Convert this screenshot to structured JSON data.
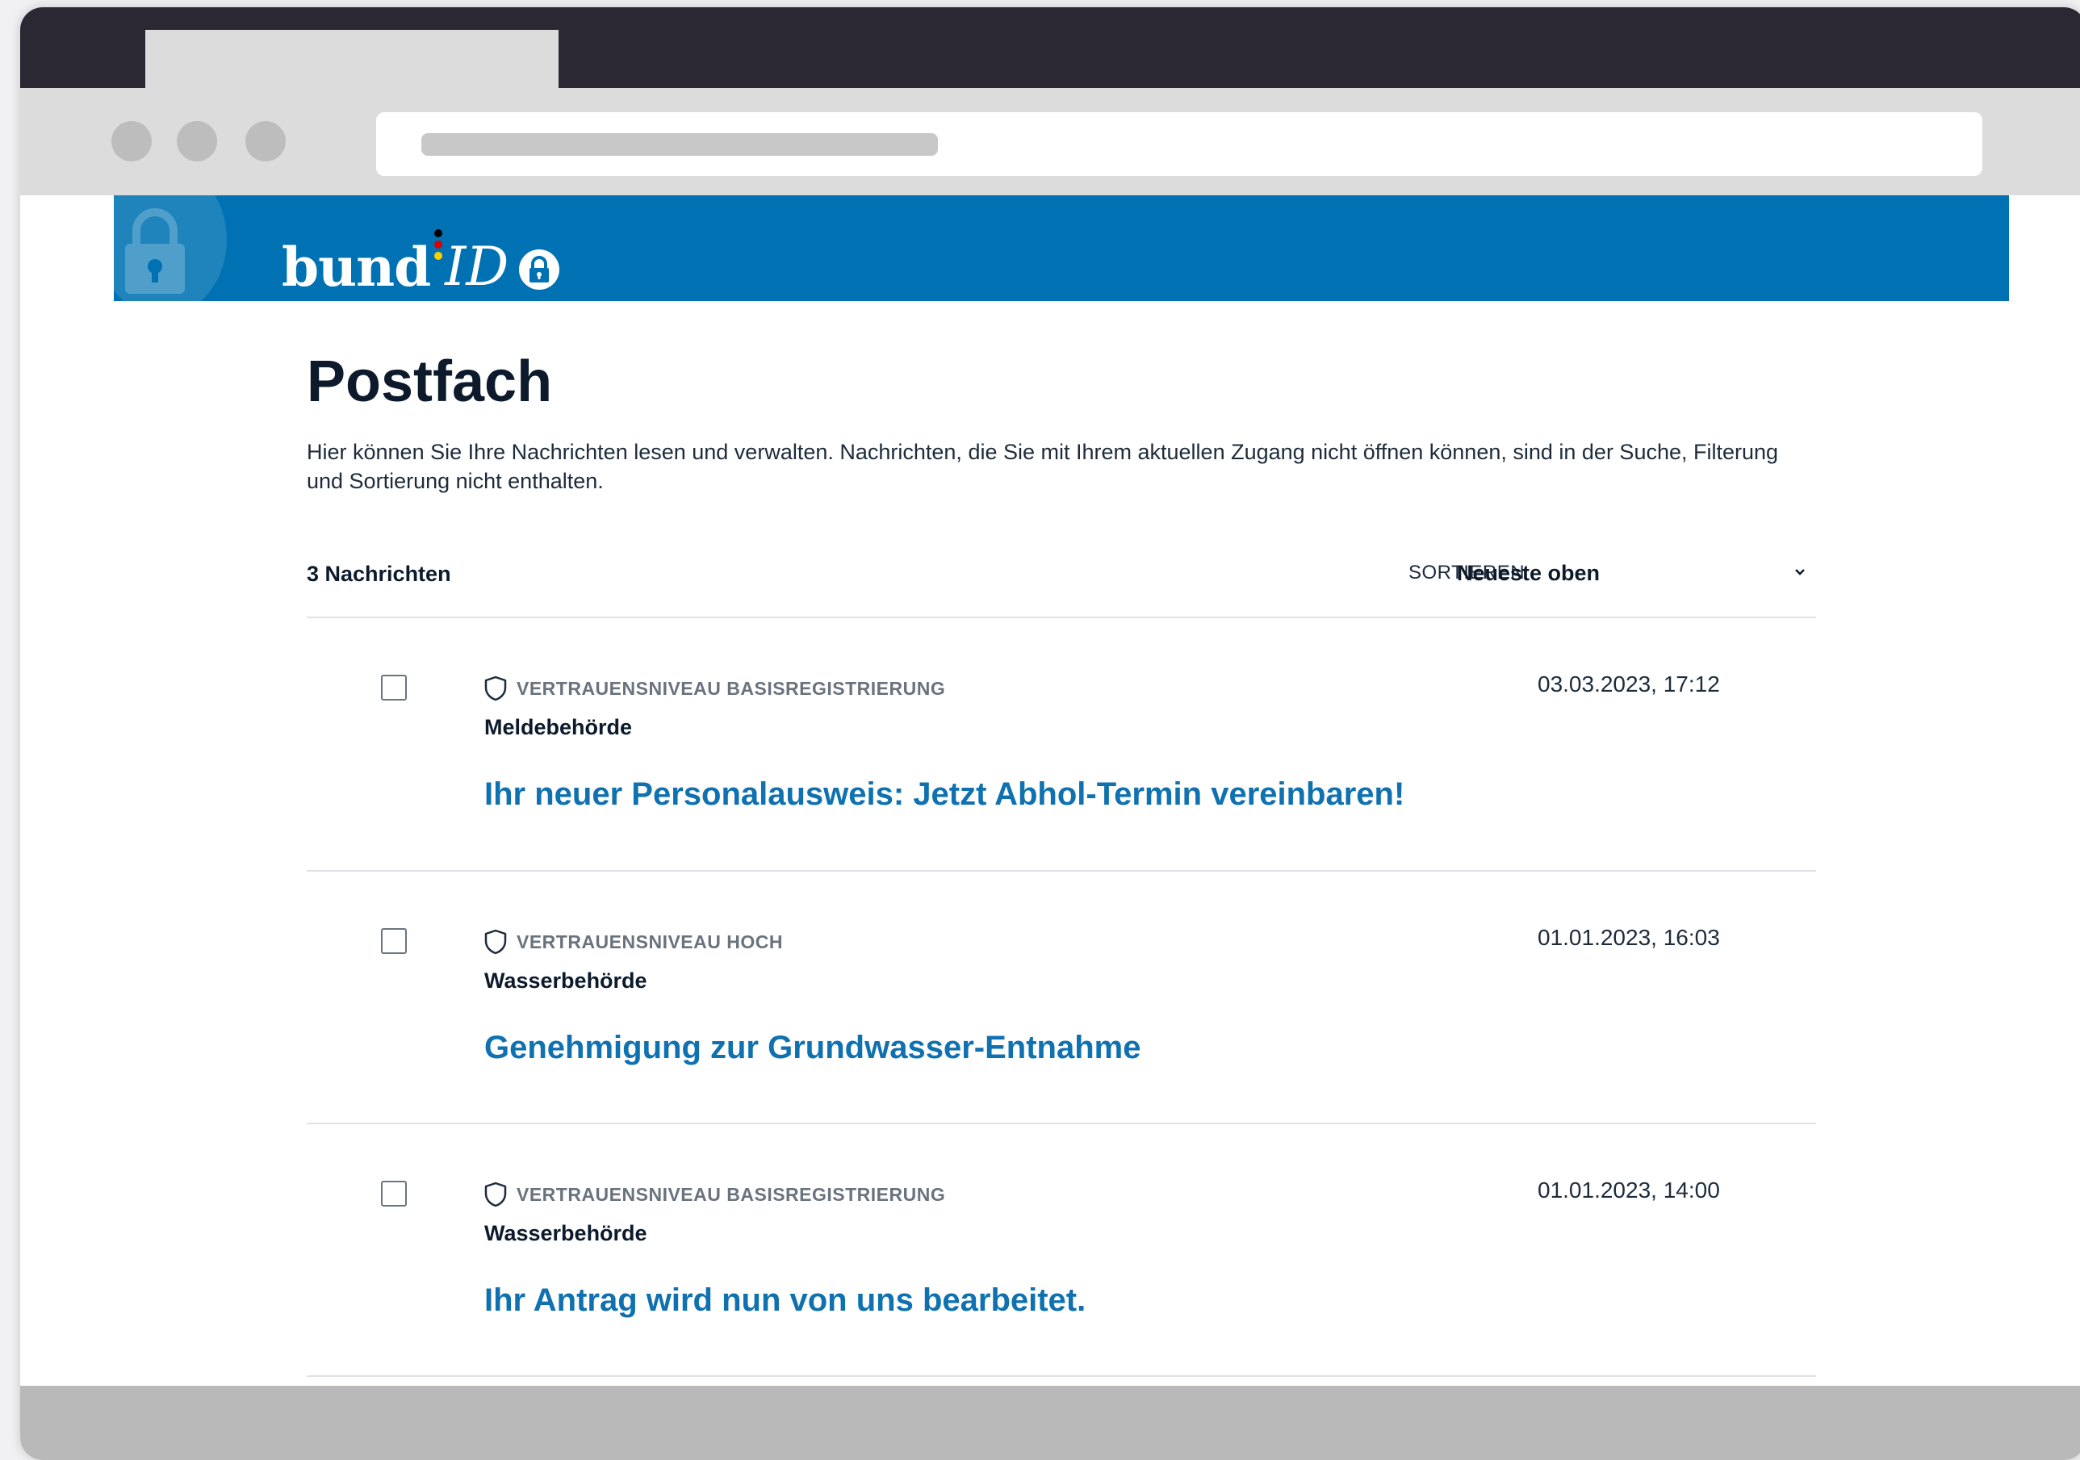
{
  "header": {
    "logo_bund": "bund",
    "logo_id": "ID",
    "brand_color": "#0072b3",
    "flag_colors": [
      "#000000",
      "#dd0000",
      "#ffce00"
    ]
  },
  "page": {
    "title": "Postfach",
    "intro": "Hier können Sie Ihre Nachrichten lesen und verwalten. Nachrichten, die Sie mit Ihrem aktuellen Zugang nicht öffnen können, sind in der Suche, Filterung und Sortierung nicht enthalten."
  },
  "list": {
    "count_label": "3 Nachrichten",
    "sort_label": "SORTIEREN",
    "sort_value": "Neueste oben",
    "messages": [
      {
        "trust_level": "VERTRAUENSNIVEAU BASISREGISTRIERUNG",
        "sender": "Meldebehörde",
        "subject": "Ihr neuer Personalausweis: Jetzt Abhol-Termin vereinbaren!",
        "date": "03.03.2023, 17:12"
      },
      {
        "trust_level": "VERTRAUENSNIVEAU HOCH",
        "sender": "Wasserbehörde",
        "subject": "Genehmigung zur Grundwasser-Entnahme",
        "date": "01.01.2023, 16:03"
      },
      {
        "trust_level": "VERTRAUENSNIVEAU BASISREGISTRIERUNG",
        "sender": "Wasserbehörde",
        "subject": "Ihr Antrag wird nun von uns bearbeitet.",
        "date": "01.01.2023, 14:00"
      }
    ]
  },
  "icons": {
    "trust": "shield-icon",
    "sort": "chevron-down-icon",
    "logo": "lock-icon"
  }
}
